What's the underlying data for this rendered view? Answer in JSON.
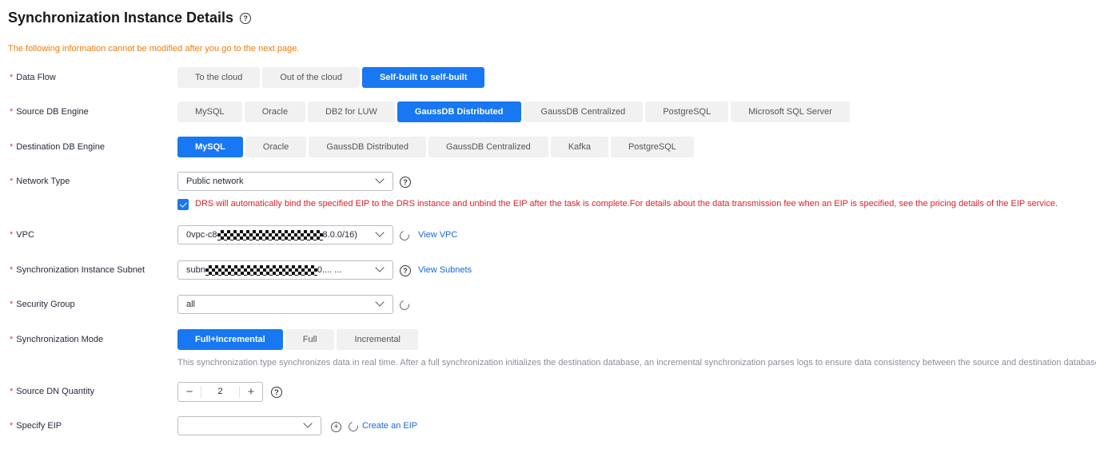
{
  "page": {
    "title": "Synchronization Instance Details",
    "notice": "The following information cannot be modified after you go to the next page."
  },
  "data_flow": {
    "label": "Data Flow",
    "options": [
      "To the cloud",
      "Out of the cloud",
      "Self-built to self-built"
    ],
    "selected": "Self-built to self-built"
  },
  "source_engine": {
    "label": "Source DB Engine",
    "options": [
      "MySQL",
      "Oracle",
      "DB2 for LUW",
      "GaussDB Distributed",
      "GaussDB Centralized",
      "PostgreSQL",
      "Microsoft SQL Server"
    ],
    "selected": "GaussDB Distributed"
  },
  "dest_engine": {
    "label": "Destination DB Engine",
    "options": [
      "MySQL",
      "Oracle",
      "GaussDB Distributed",
      "GaussDB Centralized",
      "Kafka",
      "PostgreSQL"
    ],
    "selected": "MySQL"
  },
  "network_type": {
    "label": "Network Type",
    "value": "Public network",
    "eip_notice": "DRS will automatically bind the specified EIP to the DRS instance and unbind the EIP after the task is complete.For details about the data transmission fee when an EIP is specified, see the pricing details of the EIP service.",
    "eip_checked": true
  },
  "vpc": {
    "label": "VPC",
    "value_prefix": "0vpc-c8",
    "value_suffix": "8.0.0/16)",
    "link": "View VPC"
  },
  "subnet": {
    "label": "Synchronization Instance Subnet",
    "value_prefix": "subn",
    "value_suffix": "0.... ...",
    "link": "View Subnets"
  },
  "security_group": {
    "label": "Security Group",
    "value": "all"
  },
  "sync_mode": {
    "label": "Synchronization Mode",
    "options": [
      "Full+Incremental",
      "Full",
      "Incremental"
    ],
    "selected": "Full+Incremental",
    "hint": "This synchronization type synchronizes data in real time. After a full synchronization initializes the destination database, an incremental synchronization parses logs to ensure data consistency between the source and destination databases."
  },
  "dn_quantity": {
    "label": "Source DN Quantity",
    "value": "2"
  },
  "eip": {
    "label": "Specify EIP",
    "value": "",
    "link": "Create an EIP"
  },
  "colors": {
    "primary": "#1877f2",
    "warning": "#ed7d0c",
    "error": "#d9232b",
    "required": "#e03c3c"
  }
}
